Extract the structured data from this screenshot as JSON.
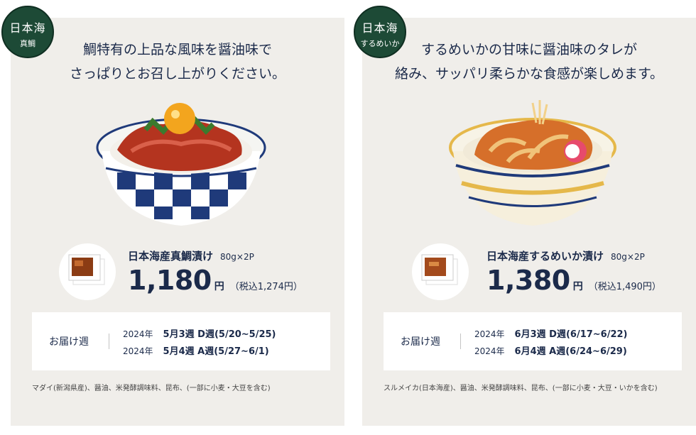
{
  "products": [
    {
      "badge_line1": "日本海",
      "badge_line2": "真鯛",
      "headline_line1": "鯛特有の上品な風味を醤油味で",
      "headline_line2": "さっぱりとお召し上がりください。",
      "name": "日本海産真鯛漬け",
      "qty": "80g×2P",
      "price": "1,180",
      "yen": "円",
      "tax_incl": "（税込1,274円）",
      "delivery_label": "お届け週",
      "deliveries": [
        {
          "year": "2024年",
          "week": "5月3週 D週(5/20~5/25)"
        },
        {
          "year": "2024年",
          "week": "5月4週 A週(5/27~6/1)"
        }
      ],
      "ingredients": "マダイ(新潟県産)、醤油、米発酵調味料、昆布、(一部に小麦・大豆を含む)"
    },
    {
      "badge_line1": "日本海",
      "badge_line2": "するめいか",
      "headline_line1": "するめいかの甘味に醤油味のタレが",
      "headline_line2": "絡み、サッパリ柔らかな食感が楽しめます。",
      "name": "日本海産するめいか漬け",
      "qty": "80g×2P",
      "price": "1,380",
      "yen": "円",
      "tax_incl": "（税込1,490円）",
      "delivery_label": "お届け週",
      "deliveries": [
        {
          "year": "2024年",
          "week": "6月3週 D週(6/17~6/22)"
        },
        {
          "year": "2024年",
          "week": "6月4週 A週(6/24~6/29)"
        }
      ],
      "ingredients": "スルメイカ(日本海産)、醤油、米発酵調味料、昆布、(一部に小麦・大豆・いかを含む)"
    }
  ],
  "colors": {
    "navy_text": "#1b2a4a",
    "badge_green": "#1d4a36",
    "card_bg": "#f0eeea"
  },
  "icons": [
    "bowl-image",
    "package-image"
  ]
}
